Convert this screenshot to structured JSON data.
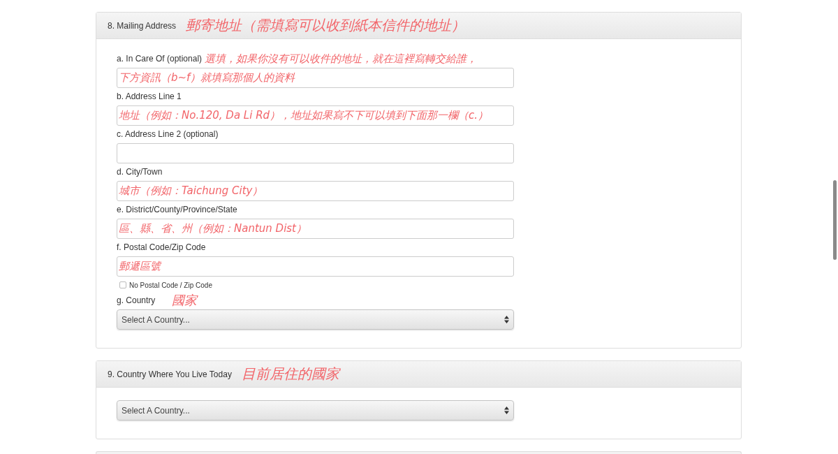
{
  "sections": [
    {
      "number": "8.",
      "title": "Mailing Address",
      "annotation": "郵寄地址（需填寫可以收到紙本信件的地址）",
      "fields": [
        {
          "kind": "text",
          "label": "a. In Care Of (optional)",
          "annotations": [
            {
              "kind": "beside_label",
              "text": "選填，如果你沒有可以收件的地址，就在這裡寫轉交給誰，"
            },
            {
              "kind": "in_field",
              "text": "下方資訊（b~f）就填寫那個人的資料"
            }
          ]
        },
        {
          "kind": "text",
          "label": "b. Address Line 1",
          "annotations": [
            {
              "kind": "in_field",
              "text": "地址（例如：No.120, Da Li Rd），地址如果寫不下可以填到下面那一欄（c.）"
            }
          ]
        },
        {
          "kind": "text",
          "label": "c. Address Line 2 (optional)"
        },
        {
          "kind": "text",
          "label": "d. City/Town",
          "annotations": [
            {
              "kind": "in_field",
              "text": "城市（例如：Taichung City）"
            }
          ]
        },
        {
          "kind": "text",
          "label": "e. District/County/Province/State",
          "annotations": [
            {
              "kind": "in_field",
              "text": "區、縣、省、州（例如：Nantun Dist）"
            }
          ]
        },
        {
          "kind": "text",
          "label": "f. Postal Code/Zip Code",
          "annotations": [
            {
              "kind": "in_field",
              "text": "郵遞區號"
            }
          ]
        },
        {
          "kind": "checkbox",
          "label": "No Postal Code / Zip Code",
          "checked": false
        },
        {
          "kind": "select",
          "label": "g. Country",
          "annotations": [
            {
              "kind": "beside_label",
              "text": "國家"
            }
          ],
          "placeholder": "Select A Country..."
        }
      ]
    },
    {
      "number": "9.",
      "title": "Country Where You Live Today",
      "annotation": "目前居住的國家",
      "fields": [
        {
          "kind": "select",
          "placeholder": "Select A Country..."
        }
      ]
    }
  ]
}
